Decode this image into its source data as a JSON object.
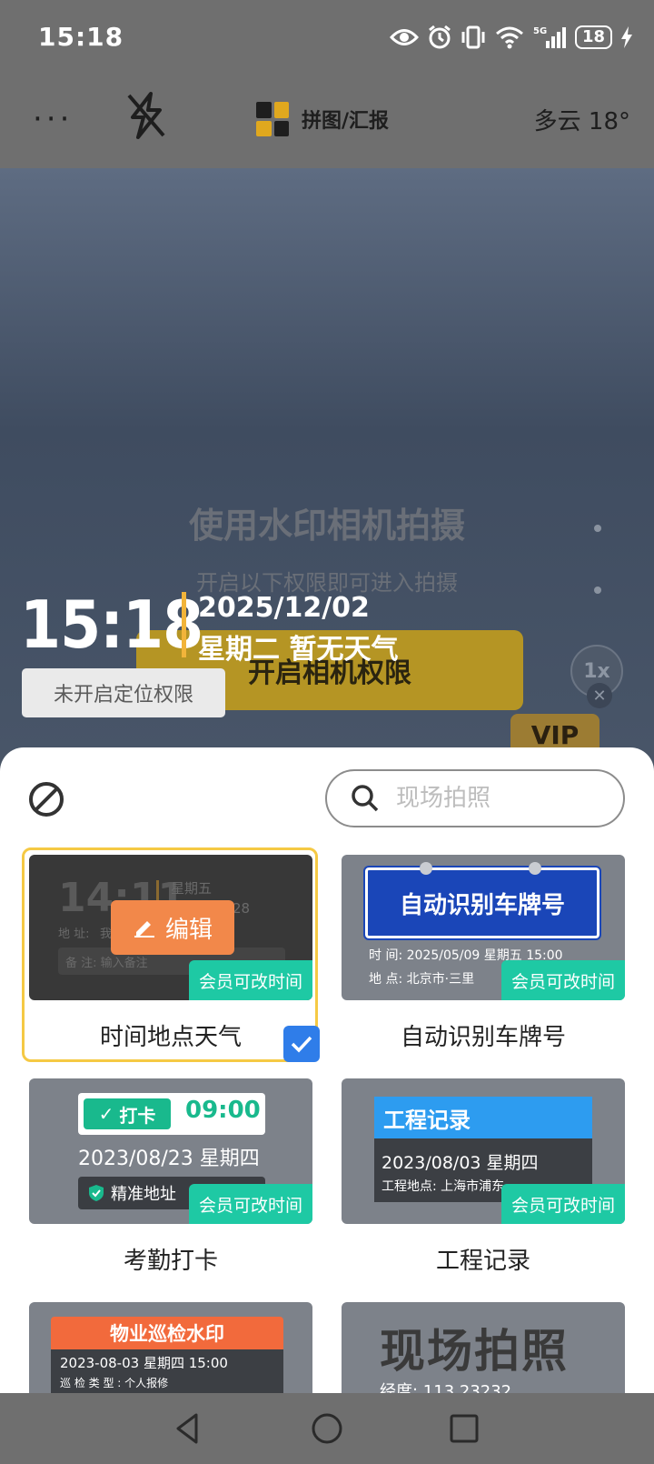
{
  "status_bar": {
    "time": "15:18",
    "battery": "18",
    "network": "5G"
  },
  "topbar": {
    "more_icon": "more-dots-icon",
    "flash_icon": "flash-off-icon",
    "mode_label": "拼图/汇报",
    "weather": "多云 18°"
  },
  "camera": {
    "title": "使用水印相机拍摄",
    "subtitle": "开启以下权限即可进入拍摄",
    "permission_button": "开启相机权限",
    "zoom": "1x",
    "vip": "VIP",
    "watermark": {
      "time": "15:18",
      "date": "2025/12/02",
      "week_weather": "星期二  暂无天气",
      "location_status": "未开启定位权限"
    }
  },
  "sheet": {
    "search_placeholder": "现场拍照",
    "edit_label": "编辑",
    "badge_label": "会员可改时间",
    "templates": [
      {
        "title": "时间地点天气",
        "selected": true,
        "preview": {
          "time": "14:11",
          "week": "星期五",
          "day": "28",
          "address_label": "地  址:",
          "address": "我",
          "note": "备  注: 输入备注"
        }
      },
      {
        "title": "自动识别车牌号",
        "preview": {
          "header": "自动识别车牌号",
          "time_line": "时  间:  2025/05/09  星期五 15:00",
          "place_line": "地  点:  北京市·三里"
        }
      },
      {
        "title": "考勤打卡",
        "preview": {
          "punch": "打卡",
          "clock": "09:00",
          "date": "2023/08/23  星期四",
          "location": "精准地址"
        }
      },
      {
        "title": "工程记录",
        "preview": {
          "header": "工程记录",
          "date": "2023/08/03    星期四",
          "place": "工程地点: 上海市浦东"
        }
      },
      {
        "title": "",
        "preview": {
          "header": "物业巡检水印",
          "date": "2023-08-03 星期四 15:00",
          "type": "巡 检 类 型 : 个人报修"
        }
      },
      {
        "title": "",
        "preview": {
          "header": "现场拍照",
          "coord": "经度:  113.23232"
        }
      }
    ]
  },
  "nav": {
    "back_icon": "back-triangle-icon",
    "home_icon": "home-circle-icon",
    "recents_icon": "recents-square-icon"
  },
  "colors": {
    "accent": "#f5c944",
    "badge": "#1ec9a4",
    "edit": "#f2884a",
    "check": "#2f7de9"
  }
}
